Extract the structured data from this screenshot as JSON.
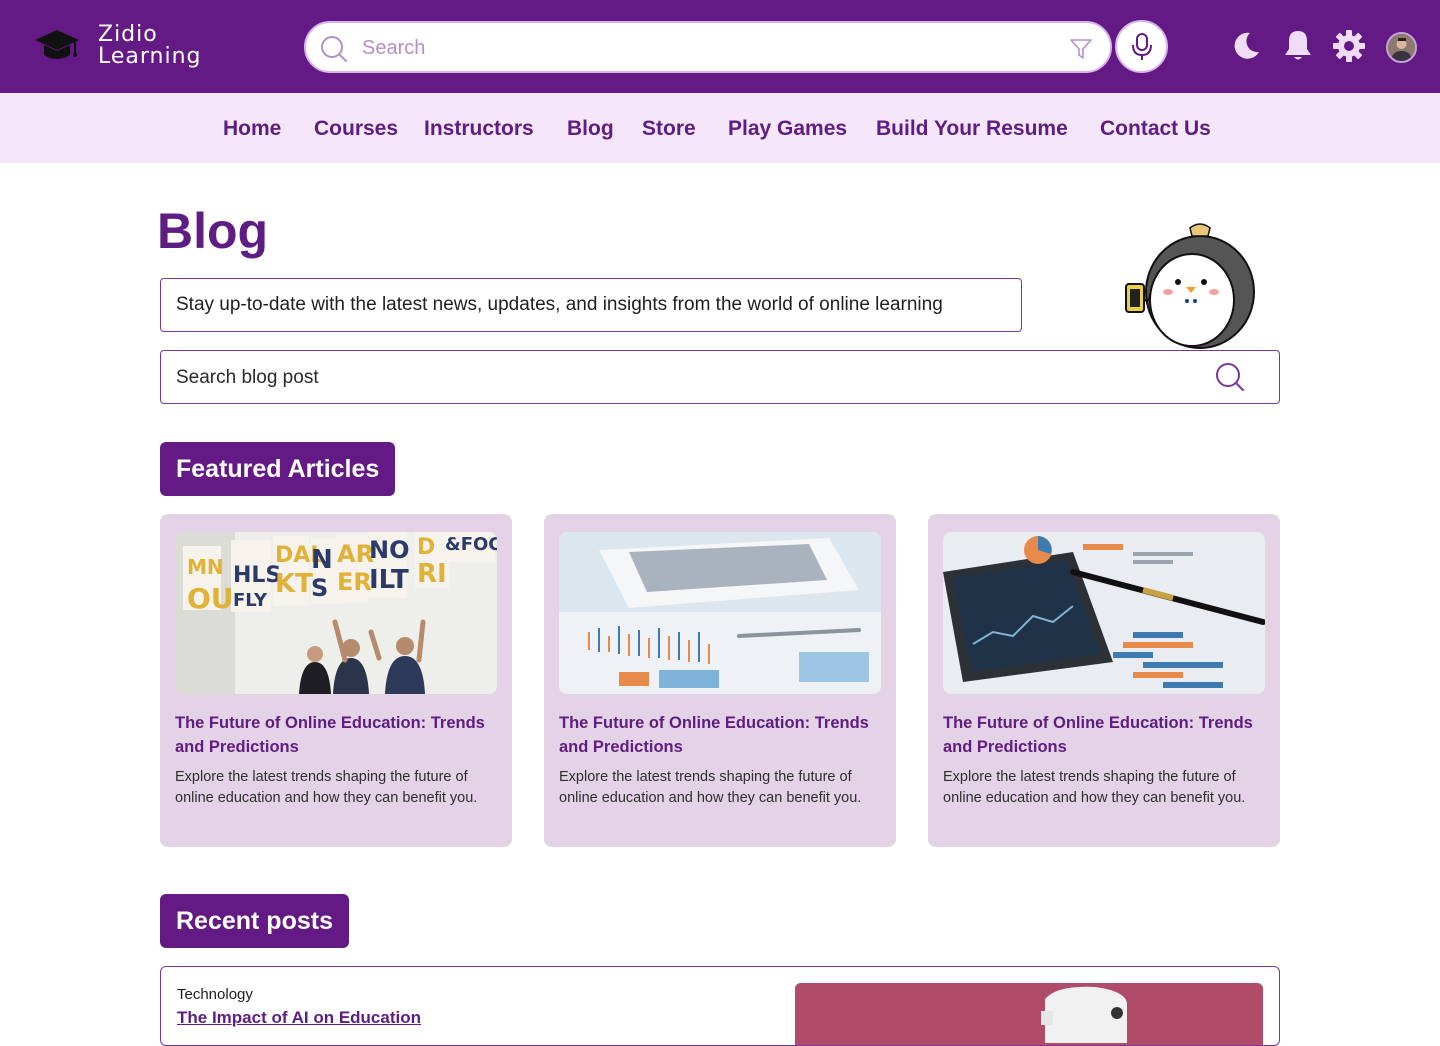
{
  "brand": {
    "line1": "Zidio",
    "line2": "Learning",
    "logo_icon": "graduation-cap-icon"
  },
  "header": {
    "search_placeholder": "Search",
    "icons": [
      "search-icon",
      "filter-icon",
      "microphone-icon",
      "moon-icon",
      "bell-icon",
      "gear-icon",
      "avatar"
    ]
  },
  "nav": {
    "items": [
      "Home",
      "Courses",
      "Instructors",
      "Blog",
      "Store",
      "Play Games",
      "Build Your Resume",
      "Contact Us"
    ]
  },
  "main": {
    "title": "Blog",
    "tagline": "Stay up-to-date with the latest news, updates, and insights from the world of online learning",
    "blog_search_placeholder": "Search blog post"
  },
  "featured": {
    "heading": "Featured Articles",
    "cards": [
      {
        "title": "The Future of Online Education: Trends and Predictions",
        "description": "Explore the latest trends shaping the future of online education and how they can benefit you."
      },
      {
        "title": "The Future of Online Education: Trends and Predictions",
        "description": "Explore the latest trends shaping the future of online education and how they can benefit you."
      },
      {
        "title": "The Future of Online Education: Trends and Predictions",
        "description": "Explore the latest trends shaping the future of online education and how they can benefit you."
      }
    ]
  },
  "recent": {
    "heading": "Recent posts",
    "posts": [
      {
        "category": "Technology",
        "title": "The Impact of AI on Education"
      }
    ]
  },
  "colors": {
    "primary": "#631a85",
    "nav_bg": "#f6e6f9",
    "card_bg": "#e4d2e6",
    "accent_text": "#5e1d82"
  }
}
